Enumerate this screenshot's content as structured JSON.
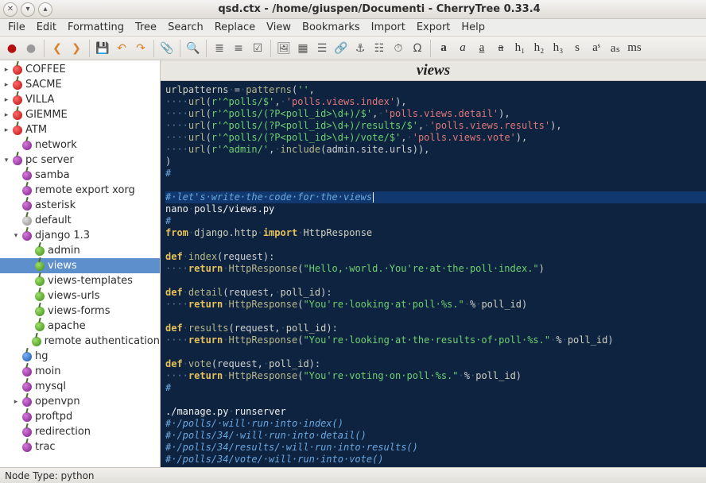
{
  "window": {
    "title": "qsd.ctx - /home/giuspen/Documenti - CherryTree 0.33.4"
  },
  "menus": [
    "File",
    "Edit",
    "Formatting",
    "Tree",
    "Search",
    "Replace",
    "View",
    "Bookmarks",
    "Import",
    "Export",
    "Help"
  ],
  "toolbar_groups": [
    [
      {
        "name": "red-cherry-icon",
        "glyph": "●",
        "color": "#b50f0f"
      },
      {
        "name": "grey-cherry-icon",
        "glyph": "●",
        "color": "#9a9a9a"
      }
    ],
    [
      {
        "name": "nav-back-icon",
        "glyph": "❮",
        "color": "#d9822b"
      },
      {
        "name": "nav-forward-icon",
        "glyph": "❯",
        "color": "#d9822b"
      }
    ],
    [
      {
        "name": "save-icon",
        "glyph": "💾",
        "color": "#555"
      },
      {
        "name": "undo-icon",
        "glyph": "↶",
        "color": "#d9822b"
      },
      {
        "name": "redo-icon",
        "glyph": "↷",
        "color": "#d9822b"
      }
    ],
    [
      {
        "name": "attach-icon",
        "glyph": "📎",
        "color": "#555"
      }
    ],
    [
      {
        "name": "search-icon",
        "glyph": "🔍",
        "color": "#555"
      }
    ],
    [
      {
        "name": "list-bullet-icon",
        "glyph": "≣",
        "color": "#555"
      },
      {
        "name": "list-number-icon",
        "glyph": "≡",
        "color": "#555"
      },
      {
        "name": "list-todo-icon",
        "glyph": "☑",
        "color": "#555"
      }
    ],
    [
      {
        "name": "insert-image-icon",
        "glyph": "🖼",
        "color": "#555"
      },
      {
        "name": "insert-table-icon",
        "glyph": "▦",
        "color": "#555"
      },
      {
        "name": "insert-codebox-icon",
        "glyph": "☰",
        "color": "#555"
      },
      {
        "name": "insert-link-icon",
        "glyph": "🔗",
        "color": "#555"
      },
      {
        "name": "insert-anchor-icon",
        "glyph": "⚓",
        "color": "#555"
      },
      {
        "name": "insert-toc-icon",
        "glyph": "☷",
        "color": "#555"
      },
      {
        "name": "insert-timestamp-icon",
        "glyph": "⏱",
        "color": "#555"
      },
      {
        "name": "insert-special-icon",
        "glyph": "Ω",
        "color": "#555"
      }
    ],
    [
      {
        "name": "fmt-bold-icon",
        "glyph": "a",
        "bold": true,
        "serif": true
      },
      {
        "name": "fmt-italic-icon",
        "glyph": "a",
        "italic": true,
        "serif": true
      },
      {
        "name": "fmt-underline-icon",
        "glyph": "a",
        "underline": true,
        "serif": true
      },
      {
        "name": "fmt-strike-icon",
        "glyph": "a",
        "strike": true,
        "serif": true
      },
      {
        "name": "fmt-h1-icon",
        "glyph": "h₁",
        "serif": true
      },
      {
        "name": "fmt-h2-icon",
        "glyph": "h₂",
        "serif": true
      },
      {
        "name": "fmt-h3-icon",
        "glyph": "h₃",
        "serif": true
      },
      {
        "name": "fmt-small-icon",
        "glyph": "s",
        "serif": true
      },
      {
        "name": "fmt-super-icon",
        "glyph": "aˢ",
        "serif": true
      },
      {
        "name": "fmt-sub-icon",
        "glyph": "aₛ",
        "serif": true
      },
      {
        "name": "fmt-mono-icon",
        "glyph": "ms",
        "serif": true
      }
    ]
  ],
  "tree": [
    {
      "label": "COFFEE",
      "depth": 0,
      "arrow": "right",
      "cherry": "red"
    },
    {
      "label": "SACME",
      "depth": 0,
      "arrow": "right",
      "cherry": "red"
    },
    {
      "label": "VILLA",
      "depth": 0,
      "arrow": "right",
      "cherry": "red"
    },
    {
      "label": "GIEMME",
      "depth": 0,
      "arrow": "right",
      "cherry": "red"
    },
    {
      "label": "ATM",
      "depth": 0,
      "arrow": "right",
      "cherry": "red"
    },
    {
      "label": "network",
      "depth": 1,
      "arrow": "none",
      "cherry": "purple"
    },
    {
      "label": "pc server",
      "depth": 0,
      "arrow": "down",
      "cherry": "purple"
    },
    {
      "label": "samba",
      "depth": 1,
      "arrow": "none",
      "cherry": "purple"
    },
    {
      "label": "remote export xorg",
      "depth": 1,
      "arrow": "none",
      "cherry": "purple"
    },
    {
      "label": "asterisk",
      "depth": 1,
      "arrow": "none",
      "cherry": "purple"
    },
    {
      "label": "default",
      "depth": 1,
      "arrow": "none",
      "cherry": "grey"
    },
    {
      "label": "django 1.3",
      "depth": 1,
      "arrow": "down",
      "cherry": "purple"
    },
    {
      "label": "admin",
      "depth": 2,
      "arrow": "none",
      "cherry": "green"
    },
    {
      "label": "views",
      "depth": 2,
      "arrow": "none",
      "cherry": "green",
      "selected": true
    },
    {
      "label": "views-templates",
      "depth": 2,
      "arrow": "none",
      "cherry": "green"
    },
    {
      "label": "views-urls",
      "depth": 2,
      "arrow": "none",
      "cherry": "green"
    },
    {
      "label": "views-forms",
      "depth": 2,
      "arrow": "none",
      "cherry": "green"
    },
    {
      "label": "apache",
      "depth": 2,
      "arrow": "none",
      "cherry": "green"
    },
    {
      "label": "remote authentication",
      "depth": 2,
      "arrow": "none",
      "cherry": "green"
    },
    {
      "label": "hg",
      "depth": 1,
      "arrow": "none",
      "cherry": "blue"
    },
    {
      "label": "moin",
      "depth": 1,
      "arrow": "none",
      "cherry": "purple"
    },
    {
      "label": "mysql",
      "depth": 1,
      "arrow": "none",
      "cherry": "purple"
    },
    {
      "label": "openvpn",
      "depth": 1,
      "arrow": "right",
      "cherry": "purple"
    },
    {
      "label": "proftpd",
      "depth": 1,
      "arrow": "none",
      "cherry": "purple"
    },
    {
      "label": "redirection",
      "depth": 1,
      "arrow": "none",
      "cherry": "purple"
    },
    {
      "label": "trac",
      "depth": 1,
      "arrow": "none",
      "cherry": "purple"
    }
  ],
  "node_title": "views",
  "statusbar": {
    "text": "Node Type: python"
  },
  "code": {
    "dots": "····",
    "lines": [
      [
        {
          "c": "tk-name",
          "t": "urlpatterns"
        },
        {
          "c": "tk-ws",
          "t": "·"
        },
        {
          "c": "tk-op",
          "t": "="
        },
        {
          "c": "tk-ws",
          "t": "·"
        },
        {
          "c": "tk-fn",
          "t": "patterns"
        },
        {
          "c": "tk-op",
          "t": "("
        },
        {
          "c": "tk-str",
          "t": "''"
        },
        {
          "c": "tk-op",
          "t": ","
        }
      ],
      [
        {
          "c": "tk-dots",
          "t": "····"
        },
        {
          "c": "tk-fn",
          "t": "url"
        },
        {
          "c": "tk-op",
          "t": "("
        },
        {
          "c": "tk-str",
          "t": "r'^polls/$'"
        },
        {
          "c": "tk-op",
          "t": ","
        },
        {
          "c": "tk-ws",
          "t": "·"
        },
        {
          "c": "tk-strr",
          "t": "'polls.views.index'"
        },
        {
          "c": "tk-op",
          "t": "),"
        }
      ],
      [
        {
          "c": "tk-dots",
          "t": "····"
        },
        {
          "c": "tk-fn",
          "t": "url"
        },
        {
          "c": "tk-op",
          "t": "("
        },
        {
          "c": "tk-str",
          "t": "r'^polls/(?P<poll_id>\\d+)/$'"
        },
        {
          "c": "tk-op",
          "t": ","
        },
        {
          "c": "tk-ws",
          "t": "·"
        },
        {
          "c": "tk-strr",
          "t": "'polls.views.detail'"
        },
        {
          "c": "tk-op",
          "t": "),"
        }
      ],
      [
        {
          "c": "tk-dots",
          "t": "····"
        },
        {
          "c": "tk-fn",
          "t": "url"
        },
        {
          "c": "tk-op",
          "t": "("
        },
        {
          "c": "tk-str",
          "t": "r'^polls/(?P<poll_id>\\d+)/results/$'"
        },
        {
          "c": "tk-op",
          "t": ","
        },
        {
          "c": "tk-ws",
          "t": "·"
        },
        {
          "c": "tk-strr",
          "t": "'polls.views.results'"
        },
        {
          "c": "tk-op",
          "t": "),"
        }
      ],
      [
        {
          "c": "tk-dots",
          "t": "····"
        },
        {
          "c": "tk-fn",
          "t": "url"
        },
        {
          "c": "tk-op",
          "t": "("
        },
        {
          "c": "tk-str",
          "t": "r'^polls/(?P<poll_id>\\d+)/vote/$'"
        },
        {
          "c": "tk-op",
          "t": ","
        },
        {
          "c": "tk-ws",
          "t": "·"
        },
        {
          "c": "tk-strr",
          "t": "'polls.views.vote'"
        },
        {
          "c": "tk-op",
          "t": "),"
        }
      ],
      [
        {
          "c": "tk-dots",
          "t": "····"
        },
        {
          "c": "tk-fn",
          "t": "url"
        },
        {
          "c": "tk-op",
          "t": "("
        },
        {
          "c": "tk-str",
          "t": "r'^admin/'"
        },
        {
          "c": "tk-op",
          "t": ","
        },
        {
          "c": "tk-ws",
          "t": "·"
        },
        {
          "c": "tk-fn",
          "t": "include"
        },
        {
          "c": "tk-op",
          "t": "(admin.site.urls)),"
        }
      ],
      [
        {
          "c": "tk-op",
          "t": ")"
        }
      ],
      [
        {
          "c": "tk-cmt",
          "t": "#"
        }
      ],
      [],
      {
        "highlight": true,
        "caret": true,
        "spans": [
          {
            "c": "tk-cmt",
            "t": "#·let's·write·the·code·for·the·views"
          }
        ]
      },
      [
        {
          "c": "tk-white",
          "t": "nano"
        },
        {
          "c": "tk-ws",
          "t": "·"
        },
        {
          "c": "tk-white",
          "t": "polls/views.py"
        }
      ],
      [
        {
          "c": "tk-cmt",
          "t": "#"
        }
      ],
      [
        {
          "c": "tk-kw",
          "t": "from"
        },
        {
          "c": "tk-ws",
          "t": "·"
        },
        {
          "c": "tk-name",
          "t": "django.http"
        },
        {
          "c": "tk-ws",
          "t": "·"
        },
        {
          "c": "tk-kw",
          "t": "import"
        },
        {
          "c": "tk-ws",
          "t": "·"
        },
        {
          "c": "tk-name",
          "t": "HttpResponse"
        }
      ],
      [],
      [
        {
          "c": "tk-kw",
          "t": "def"
        },
        {
          "c": "tk-ws",
          "t": "·"
        },
        {
          "c": "tk-fn",
          "t": "index"
        },
        {
          "c": "tk-op",
          "t": "(request):"
        }
      ],
      [
        {
          "c": "tk-dots",
          "t": "····"
        },
        {
          "c": "tk-kw",
          "t": "return"
        },
        {
          "c": "tk-ws",
          "t": "·"
        },
        {
          "c": "tk-fn",
          "t": "HttpResponse"
        },
        {
          "c": "tk-op",
          "t": "("
        },
        {
          "c": "tk-str",
          "t": "\"Hello,·world.·You're·at·the·poll·index.\""
        },
        {
          "c": "tk-op",
          "t": ")"
        }
      ],
      [],
      [
        {
          "c": "tk-kw",
          "t": "def"
        },
        {
          "c": "tk-ws",
          "t": "·"
        },
        {
          "c": "tk-fn",
          "t": "detail"
        },
        {
          "c": "tk-op",
          "t": "(request,"
        },
        {
          "c": "tk-ws",
          "t": "·"
        },
        {
          "c": "tk-name",
          "t": "poll_id"
        },
        {
          "c": "tk-op",
          "t": "):"
        }
      ],
      [
        {
          "c": "tk-dots",
          "t": "····"
        },
        {
          "c": "tk-kw",
          "t": "return"
        },
        {
          "c": "tk-ws",
          "t": "·"
        },
        {
          "c": "tk-fn",
          "t": "HttpResponse"
        },
        {
          "c": "tk-op",
          "t": "("
        },
        {
          "c": "tk-str",
          "t": "\"You're·looking·at·poll·%s.\""
        },
        {
          "c": "tk-ws",
          "t": "·"
        },
        {
          "c": "tk-op",
          "t": "%"
        },
        {
          "c": "tk-ws",
          "t": "·"
        },
        {
          "c": "tk-name",
          "t": "poll_id"
        },
        {
          "c": "tk-op",
          "t": ")"
        }
      ],
      [],
      [
        {
          "c": "tk-kw",
          "t": "def"
        },
        {
          "c": "tk-ws",
          "t": "·"
        },
        {
          "c": "tk-fn",
          "t": "results"
        },
        {
          "c": "tk-op",
          "t": "(request,"
        },
        {
          "c": "tk-ws",
          "t": "·"
        },
        {
          "c": "tk-name",
          "t": "poll_id"
        },
        {
          "c": "tk-op",
          "t": "):"
        }
      ],
      [
        {
          "c": "tk-dots",
          "t": "····"
        },
        {
          "c": "tk-kw",
          "t": "return"
        },
        {
          "c": "tk-ws",
          "t": "·"
        },
        {
          "c": "tk-fn",
          "t": "HttpResponse"
        },
        {
          "c": "tk-op",
          "t": "("
        },
        {
          "c": "tk-str",
          "t": "\"You're·looking·at·the·results·of·poll·%s.\""
        },
        {
          "c": "tk-ws",
          "t": "·"
        },
        {
          "c": "tk-op",
          "t": "%"
        },
        {
          "c": "tk-ws",
          "t": "·"
        },
        {
          "c": "tk-name",
          "t": "poll_id"
        },
        {
          "c": "tk-op",
          "t": ")"
        }
      ],
      [],
      [
        {
          "c": "tk-kw",
          "t": "def"
        },
        {
          "c": "tk-ws",
          "t": "·"
        },
        {
          "c": "tk-fn",
          "t": "vote"
        },
        {
          "c": "tk-op",
          "t": "(request,"
        },
        {
          "c": "tk-ws",
          "t": "·"
        },
        {
          "c": "tk-name",
          "t": "poll_id"
        },
        {
          "c": "tk-op",
          "t": "):"
        }
      ],
      [
        {
          "c": "tk-dots",
          "t": "····"
        },
        {
          "c": "tk-kw",
          "t": "return"
        },
        {
          "c": "tk-ws",
          "t": "·"
        },
        {
          "c": "tk-fn",
          "t": "HttpResponse"
        },
        {
          "c": "tk-op",
          "t": "("
        },
        {
          "c": "tk-str",
          "t": "\"You're·voting·on·poll·%s.\""
        },
        {
          "c": "tk-ws",
          "t": "·"
        },
        {
          "c": "tk-op",
          "t": "%"
        },
        {
          "c": "tk-ws",
          "t": "·"
        },
        {
          "c": "tk-name",
          "t": "poll_id"
        },
        {
          "c": "tk-op",
          "t": ")"
        }
      ],
      [
        {
          "c": "tk-cmt",
          "t": "#"
        }
      ],
      [],
      [
        {
          "c": "tk-white",
          "t": "./manage.py"
        },
        {
          "c": "tk-ws",
          "t": "·"
        },
        {
          "c": "tk-white",
          "t": "runserver"
        }
      ],
      [
        {
          "c": "tk-cmt",
          "t": "#·/polls/·will·run·into·index()"
        }
      ],
      [
        {
          "c": "tk-cmt",
          "t": "#·/polls/34/·will·run·into·detail()"
        }
      ],
      [
        {
          "c": "tk-cmt",
          "t": "#·/polls/34/results/·will·run·into·results()"
        }
      ],
      [
        {
          "c": "tk-cmt",
          "t": "#·/polls/34/vote/·will·run·into·vote()"
        }
      ]
    ]
  }
}
